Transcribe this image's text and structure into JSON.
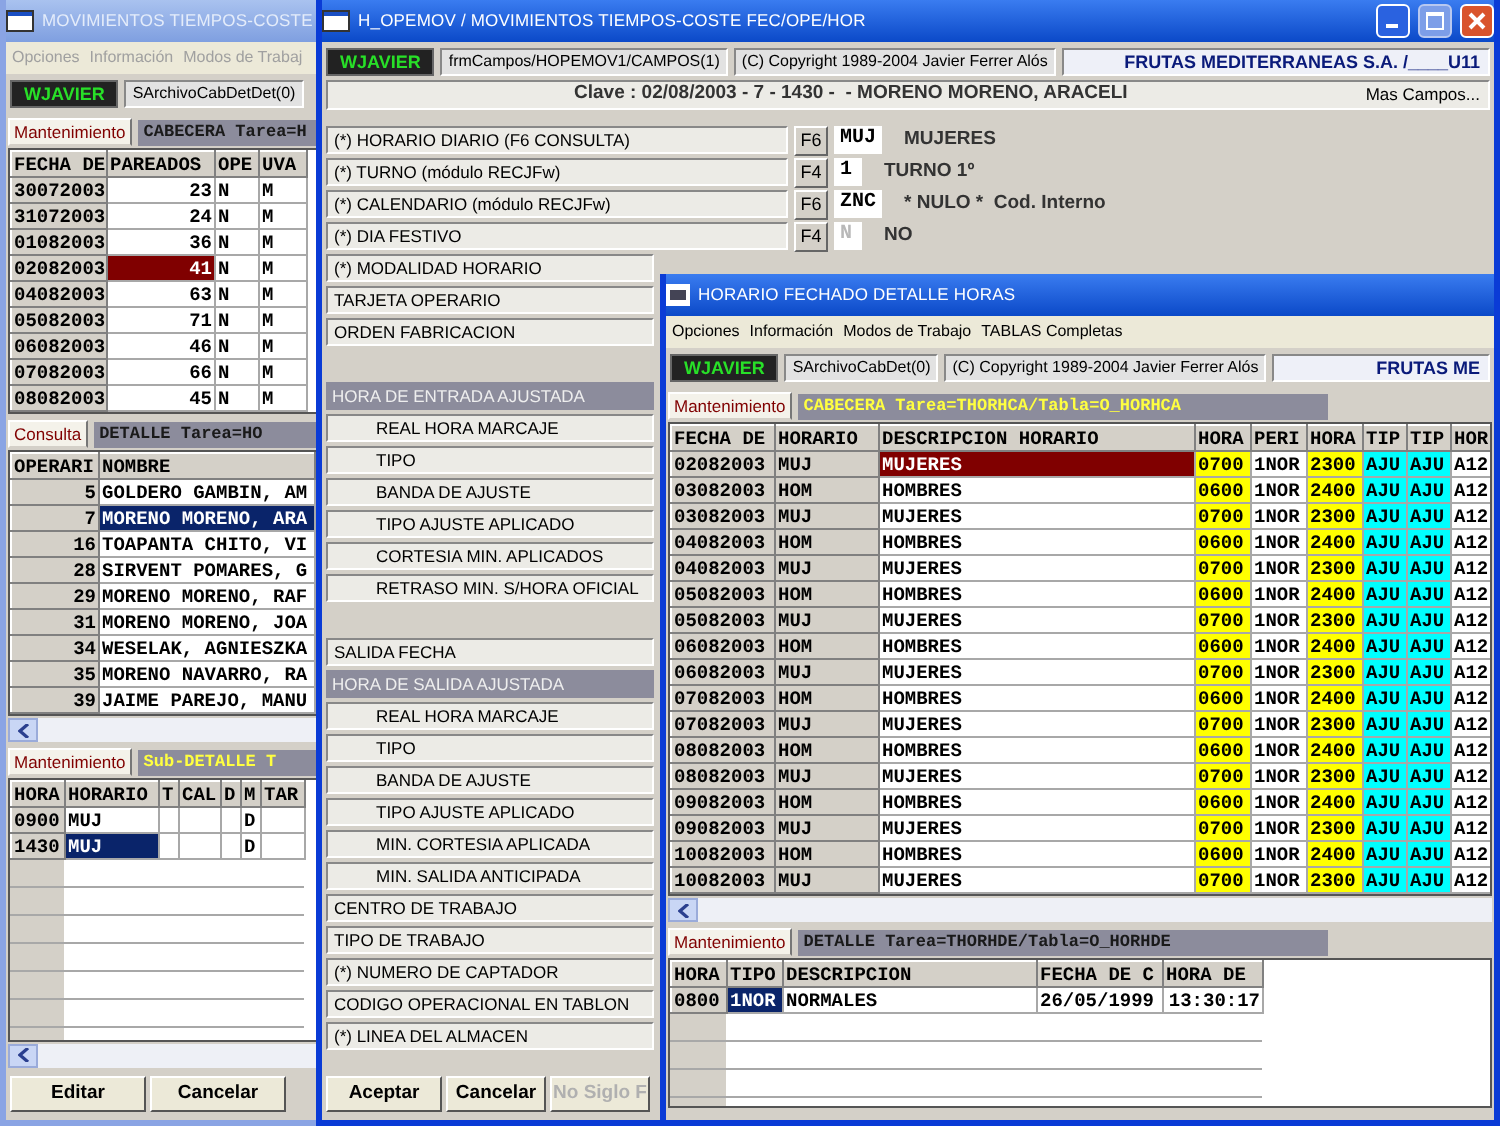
{
  "main_window": {
    "title": "MOVIMIENTOS TIEMPOS-COSTE",
    "active": false,
    "menu": [
      "Opciones",
      "Información",
      "Modos de Trabaj"
    ],
    "user": "WJAVIER",
    "toolbar_fields": [
      "SArchivoCabDetDet(0)"
    ],
    "panels": [
      {
        "tab": "Mantenimiento",
        "caption": "CABECERA Tarea=H",
        "highlighted": false,
        "grid": {
          "kind": "master",
          "columns": [
            {
              "label": "FECHA DE",
              "kind": "key"
            },
            {
              "label": "PAREADOS",
              "kind": "number"
            },
            {
              "label": "OPE",
              "kind": "text"
            },
            {
              "label": "UVA",
              "kind": "text"
            }
          ],
          "rows": [
            {
              "cells": [
                "30072003",
                "23",
                "N",
                "M"
              ],
              "selected": false
            },
            {
              "cells": [
                "31072003",
                "24",
                "N",
                "M"
              ],
              "selected": false
            },
            {
              "cells": [
                "01082003",
                "36",
                "N",
                "M"
              ],
              "selected": false
            },
            {
              "cells": [
                "02082003",
                "41",
                "N",
                "M"
              ],
              "selected": true
            },
            {
              "cells": [
                "04082003",
                "63",
                "N",
                "M"
              ],
              "selected": false
            },
            {
              "cells": [
                "05082003",
                "71",
                "N",
                "M"
              ],
              "selected": false
            },
            {
              "cells": [
                "06082003",
                "46",
                "N",
                "M"
              ],
              "selected": false
            },
            {
              "cells": [
                "07082003",
                "66",
                "N",
                "M"
              ],
              "selected": false
            },
            {
              "cells": [
                "08082003",
                "45",
                "N",
                "M"
              ],
              "selected": false
            }
          ]
        }
      },
      {
        "tab": "Consulta",
        "caption": "DETALLE Tarea=HO",
        "highlighted": false,
        "scrollbar": true,
        "grid": {
          "kind": "detail",
          "columns": [
            {
              "label": "OPERARI",
              "kind": "keynum"
            },
            {
              "label": "NOMBRE",
              "kind": "text"
            }
          ],
          "rows": [
            {
              "cells": [
                "5",
                "GOLDERO GAMBIN, AM"
              ],
              "selected": false
            },
            {
              "cells": [
                "7",
                "MORENO MORENO, ARA"
              ],
              "selected": true
            },
            {
              "cells": [
                "16",
                "TOAPANTA CHITO, VI"
              ],
              "selected": false
            },
            {
              "cells": [
                "28",
                "SIRVENT POMARES, G"
              ],
              "selected": false
            },
            {
              "cells": [
                "29",
                "MORENO MORENO, RAF"
              ],
              "selected": false
            },
            {
              "cells": [
                "31",
                "MORENO MORENO, JOA"
              ],
              "selected": false
            },
            {
              "cells": [
                "34",
                "WESELAK, AGNIESZKA"
              ],
              "selected": false
            },
            {
              "cells": [
                "35",
                "MORENO NAVARRO, RA"
              ],
              "selected": false
            },
            {
              "cells": [
                "39",
                "JAIME PAREJO, MANU"
              ],
              "selected": false
            }
          ]
        }
      },
      {
        "tab": "Mantenimiento",
        "caption": "Sub-DETALLE T",
        "highlighted": true,
        "scrollbar": true,
        "grid": {
          "kind": "detail",
          "blank_rows": true,
          "columns": [
            {
              "label": "HORA",
              "kind": "key"
            },
            {
              "label": "HORARIO",
              "kind": "text"
            },
            {
              "label": "T",
              "kind": "text"
            },
            {
              "label": "CAL",
              "kind": "text"
            },
            {
              "label": "D",
              "kind": "text"
            },
            {
              "label": "M",
              "kind": "text"
            },
            {
              "label": "TAR",
              "kind": "text"
            }
          ],
          "rows": [
            {
              "cells": [
                "0900",
                "MUJ",
                null,
                null,
                null,
                "D",
                null
              ],
              "selected": false
            },
            {
              "cells": [
                "1430",
                "MUJ",
                null,
                null,
                null,
                "D",
                null
              ],
              "selected": true
            }
          ]
        }
      }
    ],
    "buttons": [
      {
        "label": "Editar",
        "disabled": false
      },
      {
        "label": "Cancelar",
        "disabled": false
      }
    ]
  },
  "editor_window": {
    "title": "H_OPEMOV / MOVIMIENTOS TIEMPOS-COSTE FEC/OPE/HOR",
    "active": true,
    "window_buttons": [
      {
        "kind": "minimize",
        "disabled": false
      },
      {
        "kind": "maximize",
        "disabled": true
      },
      {
        "kind": "close",
        "disabled": false
      }
    ],
    "user": "WJAVIER",
    "toolbar_fields": [
      "frmCampos/HOPEMOV1/CAMPOS(1)",
      "(C) Copyright 1989-2004 Javier Ferrer Alós"
    ],
    "company": "FRUTAS MEDITERRANEAS S.A. /____U11",
    "key_line": "Clave : 02/08/2003 - 7 - 1430 -  - MORENO MORENO, ARACELI",
    "more_link": "Mas Campos...",
    "fields": [
      {
        "kind": "field",
        "label": "(*) HORARIO DIARIO (F6 CONSULTA)",
        "key": "F6",
        "value": "MUJ",
        "description": "MUJERES",
        "disabled": false
      },
      {
        "kind": "field",
        "label": "(*) TURNO (módulo RECJFw)",
        "key": "F4",
        "value": "1",
        "description": "TURNO 1º",
        "disabled": false
      },
      {
        "kind": "field",
        "label": "(*) CALENDARIO (módulo RECJFw)",
        "key": "F6",
        "value": "ZNC",
        "description": "* NULO *  Cod. Interno",
        "disabled": false
      },
      {
        "kind": "field",
        "label": "(*) DIA FESTIVO",
        "key": "F4",
        "value": "N",
        "description": "NO",
        "disabled": true
      },
      {
        "kind": "field",
        "label": "(*) MODALIDAD HORARIO"
      },
      {
        "kind": "field",
        "label": "TARJETA OPERARIO"
      },
      {
        "kind": "field",
        "label": "ORDEN FABRICACION"
      },
      {
        "kind": "section",
        "label": "HORA DE ENTRADA AJUSTADA",
        "gap_before": true
      },
      {
        "kind": "subfield",
        "label": "REAL HORA MARCAJE"
      },
      {
        "kind": "subfield",
        "label": "TIPO"
      },
      {
        "kind": "subfield",
        "label": "BANDA DE AJUSTE"
      },
      {
        "kind": "subfield",
        "label": "TIPO AJUSTE APLICADO"
      },
      {
        "kind": "subfield",
        "label": "CORTESIA MIN. APLICADOS"
      },
      {
        "kind": "subfield",
        "label": "RETRASO MIN. S/HORA OFICIAL"
      },
      {
        "kind": "field",
        "label": "SALIDA FECHA",
        "gap_before": true
      },
      {
        "kind": "section",
        "label": "HORA DE SALIDA AJUSTADA"
      },
      {
        "kind": "subfield",
        "label": "REAL HORA MARCAJE"
      },
      {
        "kind": "subfield",
        "label": "TIPO"
      },
      {
        "kind": "subfield",
        "label": "BANDA DE AJUSTE"
      },
      {
        "kind": "subfield",
        "label": "TIPO AJUSTE APLICADO"
      },
      {
        "kind": "subfield",
        "label": "MIN. CORTESIA APLICADA"
      },
      {
        "kind": "subfield",
        "label": "MIN. SALIDA ANTICIPADA"
      },
      {
        "kind": "field",
        "label": "CENTRO DE TRABAJO"
      },
      {
        "kind": "field",
        "label": "TIPO DE TRABAJO"
      },
      {
        "kind": "field",
        "label": "(*) NUMERO DE CAPTADOR"
      },
      {
        "kind": "field",
        "label": "CODIGO OPERACIONAL EN TABLON"
      },
      {
        "kind": "field",
        "label": "(*) LINEA DEL ALMACEN"
      }
    ],
    "buttons": [
      {
        "label": "Aceptar",
        "disabled": false
      },
      {
        "label": "Cancelar",
        "disabled": false
      },
      {
        "label": "No Siglo F",
        "disabled": true
      }
    ]
  },
  "detail_window": {
    "title": "HORARIO FECHADO DETALLE HORAS",
    "active": true,
    "menu": [
      "Opciones",
      "Información",
      "Modos de Trabajo",
      "TABLAS Completas"
    ],
    "user": "WJAVIER",
    "toolbar_fields": [
      "SArchivoCabDet(0)",
      "(C) Copyright 1989-2004 Javier Ferrer Alós"
    ],
    "company": "FRUTAS ME",
    "panels": [
      {
        "tab": "Mantenimiento",
        "caption": "CABECERA Tarea=THORHCA/Tabla=O_HORHCA",
        "highlighted": true,
        "scrollbar": true,
        "grid": {
          "kind": "master",
          "columns": [
            {
              "label": "FECHA DE",
              "kind": "key"
            },
            {
              "label": "HORARIO",
              "kind": "key"
            },
            {
              "label": "DESCRIPCION HORARIO",
              "kind": "text"
            },
            {
              "label": "HORA",
              "kind": "text",
              "color": "#ffff00"
            },
            {
              "label": "PERI",
              "kind": "text"
            },
            {
              "label": "HORA",
              "kind": "text",
              "color": "#ffff00"
            },
            {
              "label": "TIP",
              "kind": "text",
              "color": "#00ffff"
            },
            {
              "label": "TIP",
              "kind": "text",
              "color": "#00ffff"
            },
            {
              "label": "HOR",
              "kind": "text"
            }
          ],
          "rows": [
            {
              "cells": [
                "02082003",
                "MUJ",
                "MUJERES",
                "0700",
                "1NOR",
                "2300",
                "AJU",
                "AJU",
                "A12"
              ],
              "selected": true
            },
            {
              "cells": [
                "03082003",
                "HOM",
                "HOMBRES",
                "0600",
                "1NOR",
                "2400",
                "AJU",
                "AJU",
                "A12"
              ],
              "selected": false
            },
            {
              "cells": [
                "03082003",
                "MUJ",
                "MUJERES",
                "0700",
                "1NOR",
                "2300",
                "AJU",
                "AJU",
                "A12"
              ],
              "selected": false
            },
            {
              "cells": [
                "04082003",
                "HOM",
                "HOMBRES",
                "0600",
                "1NOR",
                "2400",
                "AJU",
                "AJU",
                "A12"
              ],
              "selected": false
            },
            {
              "cells": [
                "04082003",
                "MUJ",
                "MUJERES",
                "0700",
                "1NOR",
                "2300",
                "AJU",
                "AJU",
                "A12"
              ],
              "selected": false
            },
            {
              "cells": [
                "05082003",
                "HOM",
                "HOMBRES",
                "0600",
                "1NOR",
                "2400",
                "AJU",
                "AJU",
                "A12"
              ],
              "selected": false
            },
            {
              "cells": [
                "05082003",
                "MUJ",
                "MUJERES",
                "0700",
                "1NOR",
                "2300",
                "AJU",
                "AJU",
                "A12"
              ],
              "selected": false
            },
            {
              "cells": [
                "06082003",
                "HOM",
                "HOMBRES",
                "0600",
                "1NOR",
                "2400",
                "AJU",
                "AJU",
                "A12"
              ],
              "selected": false
            },
            {
              "cells": [
                "06082003",
                "MUJ",
                "MUJERES",
                "0700",
                "1NOR",
                "2300",
                "AJU",
                "AJU",
                "A12"
              ],
              "selected": false
            },
            {
              "cells": [
                "07082003",
                "HOM",
                "HOMBRES",
                "0600",
                "1NOR",
                "2400",
                "AJU",
                "AJU",
                "A12"
              ],
              "selected": false
            },
            {
              "cells": [
                "07082003",
                "MUJ",
                "MUJERES",
                "0700",
                "1NOR",
                "2300",
                "AJU",
                "AJU",
                "A12"
              ],
              "selected": false
            },
            {
              "cells": [
                "08082003",
                "HOM",
                "HOMBRES",
                "0600",
                "1NOR",
                "2400",
                "AJU",
                "AJU",
                "A12"
              ],
              "selected": false
            },
            {
              "cells": [
                "08082003",
                "MUJ",
                "MUJERES",
                "0700",
                "1NOR",
                "2300",
                "AJU",
                "AJU",
                "A12"
              ],
              "selected": false
            },
            {
              "cells": [
                "09082003",
                "HOM",
                "HOMBRES",
                "0600",
                "1NOR",
                "2400",
                "AJU",
                "AJU",
                "A12"
              ],
              "selected": false
            },
            {
              "cells": [
                "09082003",
                "MUJ",
                "MUJERES",
                "0700",
                "1NOR",
                "2300",
                "AJU",
                "AJU",
                "A12"
              ],
              "selected": false
            },
            {
              "cells": [
                "10082003",
                "HOM",
                "HOMBRES",
                "0600",
                "1NOR",
                "2400",
                "AJU",
                "AJU",
                "A12"
              ],
              "selected": false
            },
            {
              "cells": [
                "10082003",
                "MUJ",
                "MUJERES",
                "0700",
                "1NOR",
                "2300",
                "AJU",
                "AJU",
                "A12"
              ],
              "selected": false
            }
          ]
        }
      },
      {
        "tab": "Mantenimiento",
        "caption": "DETALLE Tarea=THORHDE/Tabla=O_HORHDE",
        "highlighted": false,
        "grid": {
          "kind": "detail",
          "blank_rows": true,
          "columns": [
            {
              "label": "HORA",
              "kind": "key"
            },
            {
              "label": "TIPO",
              "kind": "text"
            },
            {
              "label": "DESCRIPCION",
              "kind": "text"
            },
            {
              "label": "FECHA DE C",
              "kind": "text"
            },
            {
              "label": "HORA DE",
              "kind": "number"
            }
          ],
          "rows": [
            {
              "cells": [
                "0800",
                "1NOR",
                "NORMALES",
                "26/05/1999",
                "13:30:17"
              ],
              "selected": true
            }
          ]
        }
      }
    ]
  }
}
